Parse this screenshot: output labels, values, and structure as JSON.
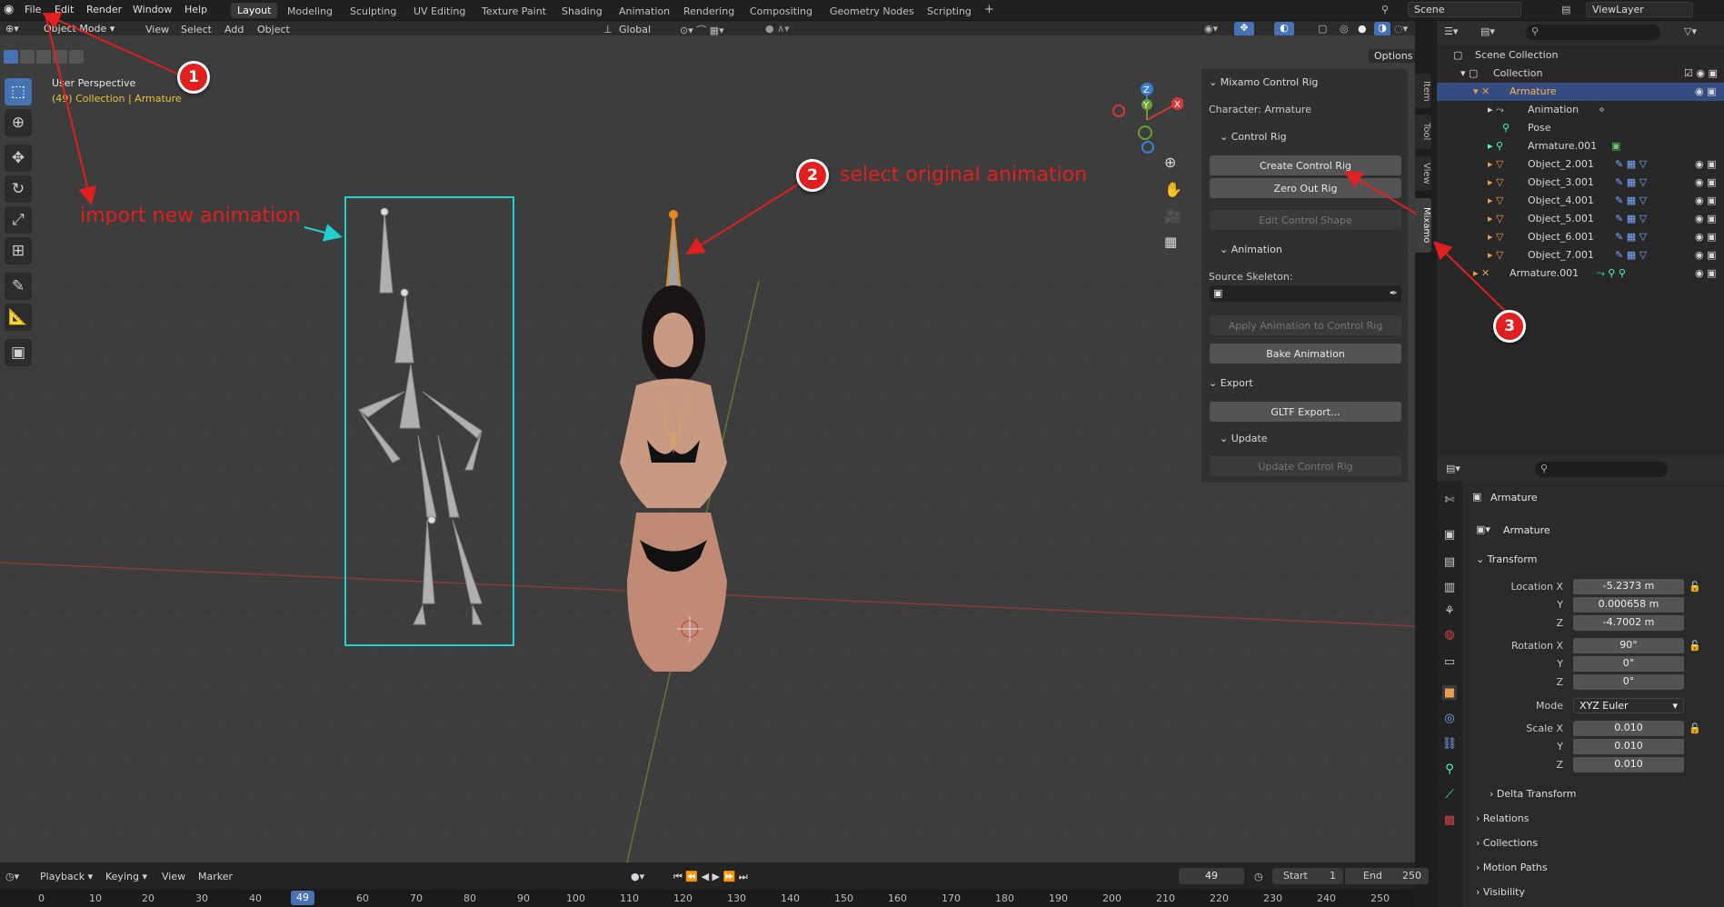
{
  "topbar": {
    "menus": [
      "File",
      "Edit",
      "Render",
      "Window",
      "Help"
    ],
    "workspaces": [
      "Layout",
      "Modeling",
      "Sculpting",
      "UV Editing",
      "Texture Paint",
      "Shading",
      "Animation",
      "Rendering",
      "Compositing",
      "Geometry Nodes",
      "Scripting"
    ],
    "add_tab": "+",
    "scene": "Scene",
    "view_layer": "ViewLayer"
  },
  "viewport_header": {
    "mode": "Object Mode",
    "menus": [
      "View",
      "Select",
      "Add",
      "Object"
    ],
    "orientation": "Global",
    "options": "Options"
  },
  "viewport": {
    "perspective": "User Perspective",
    "collection_info": "(49) Collection | Armature"
  },
  "npanel": {
    "title": "Mixamo Control Rig",
    "character": "Character: Armature",
    "control_rig": "Control Rig",
    "create_control_rig": "Create Control Rig",
    "zero_out_rig": "Zero Out Rig",
    "edit_control_shape": "Edit Control Shape",
    "animation": "Animation",
    "source_skeleton": "Source Skeleton:",
    "apply_animation": "Apply Animation to Control Rig",
    "bake_animation": "Bake Animation",
    "export": "Export",
    "gltf_export": "GLTF Export...",
    "update": "Update",
    "update_control_rig": "Update Control Rig",
    "tabs": [
      "Item",
      "Tool",
      "View",
      "Mixamo"
    ]
  },
  "outliner": {
    "scene_collection": "Scene Collection",
    "rows": [
      {
        "label": "Collection"
      },
      {
        "label": "Armature"
      },
      {
        "label": "Animation"
      },
      {
        "label": "Pose"
      },
      {
        "label": "Armature.001"
      },
      {
        "label": "Object_2.001"
      },
      {
        "label": "Object_3.001"
      },
      {
        "label": "Object_4.001"
      },
      {
        "label": "Object_5.001"
      },
      {
        "label": "Object_6.001"
      },
      {
        "label": "Object_7.001"
      },
      {
        "label": "Armature.001"
      }
    ]
  },
  "properties": {
    "object_name": "Armature",
    "data_name": "Armature",
    "transform": "Transform",
    "fields": [
      {
        "label": "Location X",
        "value": "-5.2373 m"
      },
      {
        "label": "Y",
        "value": "0.000658 m"
      },
      {
        "label": "Z",
        "value": "-4.7002 m"
      },
      {
        "label": "Rotation X",
        "value": "90°"
      },
      {
        "label": "Y",
        "value": "0°"
      },
      {
        "label": "Z",
        "value": "0°"
      },
      {
        "label": "Mode",
        "value": "XYZ Euler"
      },
      {
        "label": "Scale X",
        "value": "0.010"
      },
      {
        "label": "Y",
        "value": "0.010"
      },
      {
        "label": "Z",
        "value": "0.010"
      }
    ],
    "sections": [
      "Delta Transform",
      "Relations",
      "Collections",
      "Motion Paths",
      "Visibility"
    ]
  },
  "timeline": {
    "menus": [
      "Playback",
      "Keying",
      "View",
      "Marker"
    ],
    "current_frame": "49",
    "start_label": "Start",
    "start": "1",
    "end_label": "End",
    "end": "250",
    "ticks": [
      "0",
      "10",
      "20",
      "30",
      "40",
      "49",
      "60",
      "70",
      "80",
      "90",
      "100",
      "110",
      "120",
      "130",
      "140",
      "150",
      "160",
      "170",
      "180",
      "190",
      "200",
      "210",
      "220",
      "230",
      "240",
      "250"
    ]
  },
  "annotations": {
    "import_text": "import new animation",
    "select_text": "select original animation",
    "badge1": "1",
    "badge2": "2",
    "badge3": "3"
  }
}
